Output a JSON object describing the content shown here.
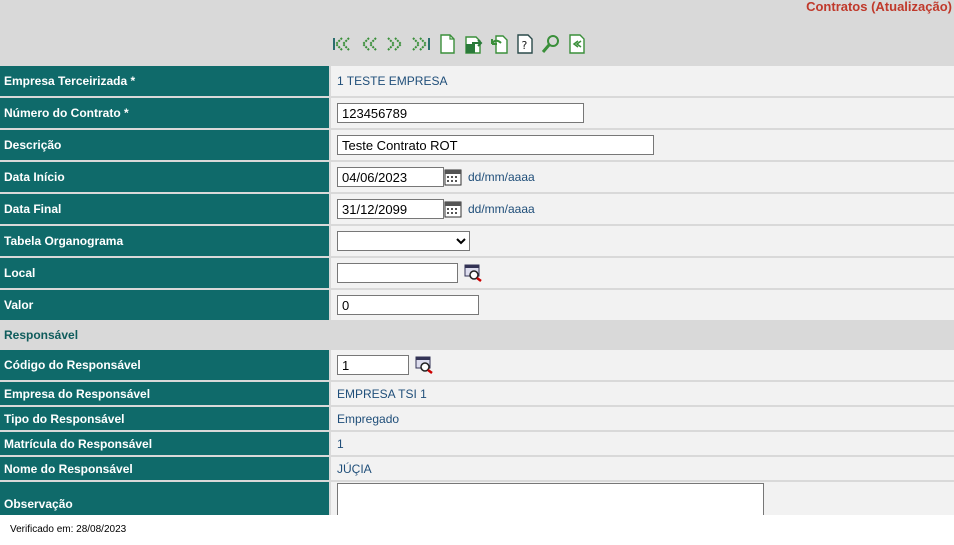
{
  "page": {
    "title": "Contratos (Atualização)"
  },
  "toolbar": {
    "icons": [
      "first-record-icon",
      "previous-record-icon",
      "next-record-icon",
      "last-record-icon",
      "new-document-icon",
      "save-export-icon",
      "undo-back-icon",
      "help-document-icon",
      "search-icon",
      "return-icon"
    ]
  },
  "form": {
    "empresa": {
      "label": "Empresa Terceirizada *",
      "value": "1 TESTE EMPRESA"
    },
    "numero": {
      "label": "Número do Contrato *",
      "value": "123456789"
    },
    "descricao": {
      "label": "Descrição",
      "value": "Teste Contrato ROT"
    },
    "data_inicio": {
      "label": "Data Início",
      "value": "04/06/2023",
      "hint": "dd/mm/aaaa"
    },
    "data_final": {
      "label": "Data Final",
      "value": "31/12/2099",
      "hint": "dd/mm/aaaa"
    },
    "tabela": {
      "label": "Tabela Organograma",
      "value": ""
    },
    "local": {
      "label": "Local",
      "value": ""
    },
    "valor": {
      "label": "Valor",
      "value": "0"
    }
  },
  "responsavel": {
    "section_title": "Responsável",
    "codigo": {
      "label": "Código do Responsável",
      "value": "1"
    },
    "empresa": {
      "label": "Empresa do Responsável",
      "value": "EMPRESA TSI 1"
    },
    "tipo": {
      "label": "Tipo do Responsável",
      "value": "Empregado"
    },
    "matricula": {
      "label": "Matrícula do Responsável",
      "value": "1"
    },
    "nome": {
      "label": "Nome do Responsável",
      "value": "JÚÇIA"
    },
    "observacao": {
      "label": "Observação",
      "value": ""
    }
  },
  "footer": {
    "text": "Verificado em: 28/08/2023"
  },
  "colors": {
    "label_bg": "#0f6a6a",
    "title_red": "#c0392b",
    "value_text": "#1f4e79"
  }
}
